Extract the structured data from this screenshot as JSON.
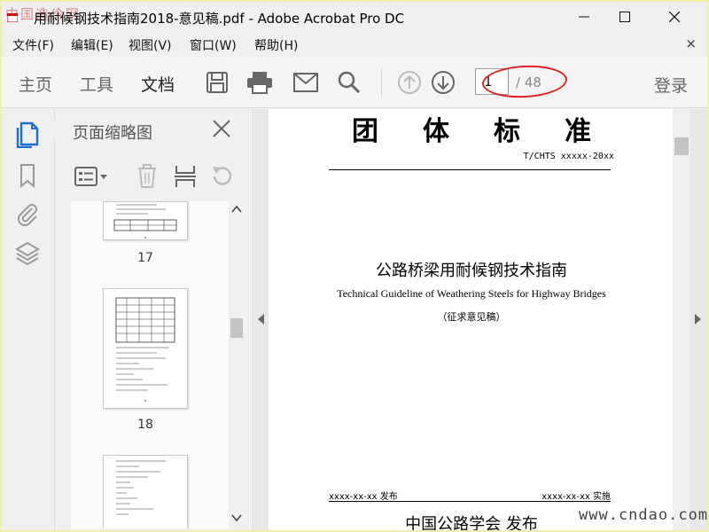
{
  "window": {
    "title": "用耐候钢技术指南2018-意见稿.pdf - Adobe Acrobat Pro DC",
    "watermark_top": "中国造价网",
    "minimize_label": "—",
    "maximize_label": "☐",
    "close_label": "✕"
  },
  "menubar": {
    "items": [
      {
        "label": "文件(F)"
      },
      {
        "label": "编辑(E)"
      },
      {
        "label": "视图(V)"
      },
      {
        "label": "窗口(W)"
      },
      {
        "label": "帮助(H)"
      }
    ],
    "close_label": "×"
  },
  "toolbar": {
    "tabs": [
      {
        "label": "主页"
      },
      {
        "label": "工具"
      },
      {
        "label": "文档"
      }
    ],
    "current_page": "1",
    "total_pages": "/ 48",
    "login_label": "登录"
  },
  "thumbnail_panel": {
    "title": "页面缩略图",
    "pages": [
      {
        "label": "17"
      },
      {
        "label": "18"
      }
    ]
  },
  "document": {
    "heading": "团体标准",
    "code": "T/CHTS xxxxx-20xx",
    "title_cn": "公路桥梁用耐候钢技术指南",
    "title_en": "Technical Guideline of Weathering Steels for Highway Bridges",
    "subtitle": "（征求意见稿）",
    "issue_date": "xxxx-xx-xx 发布",
    "implement_date": "xxxx-xx-xx 实施",
    "publisher": "中国公路学会 发布"
  },
  "footer": {
    "watermark": "www.cndao.com"
  },
  "colors": {
    "accent_blue": "#1f6fd1",
    "highlight_red": "#e02020",
    "border_yellow": "#f2f0a8"
  }
}
